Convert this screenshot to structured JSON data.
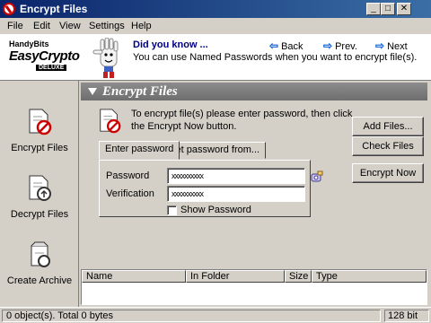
{
  "window": {
    "title": "Encrypt Files",
    "minimize": "_",
    "maximize": "□",
    "close": "✕"
  },
  "menu": [
    "File",
    "Edit",
    "View",
    "Settings",
    "Help"
  ],
  "header": {
    "logo_vendor": "HandyBits",
    "logo_product": "EasyCrypto",
    "logo_edition": "DELUXE",
    "tip_title": "Did you know ...",
    "tip_text": "You can use Named Passwords when you want to encrypt file(s).",
    "nav": {
      "back": "Back",
      "prev": "Prev.",
      "next": "Next"
    }
  },
  "sidebar": [
    {
      "label": "Encrypt Files",
      "icon": "encrypt-files-icon"
    },
    {
      "label": "Decrypt Files",
      "icon": "decrypt-files-icon"
    },
    {
      "label": "Create Archive",
      "icon": "create-archive-icon"
    }
  ],
  "section": {
    "title": "Encrypt Files",
    "instructions": "To encrypt file(s) please enter password, then click the Encrypt Now button."
  },
  "buttons": {
    "add_files": "Add Files...",
    "check_files": "Check Files",
    "encrypt_now": "Encrypt Now"
  },
  "tabs": {
    "enter_password": "Enter password",
    "get_password": "Get password from..."
  },
  "form": {
    "password_label": "Password",
    "password_value": "xxxxxxxxxx",
    "verification_label": "Verification",
    "verification_value": "xxxxxxxxxx",
    "show_password_label": "Show Password",
    "show_password_checked": false
  },
  "list": {
    "columns": [
      "Name",
      "In Folder",
      "Size",
      "Type"
    ],
    "rows": []
  },
  "status": {
    "left": "0 object(s). Total 0 bytes",
    "right": "128 bit"
  },
  "colors": {
    "title_bar": "#0a246a",
    "accent_link": "#000080",
    "section_header": "#7a7a7a",
    "icon_red": "#c00000"
  }
}
